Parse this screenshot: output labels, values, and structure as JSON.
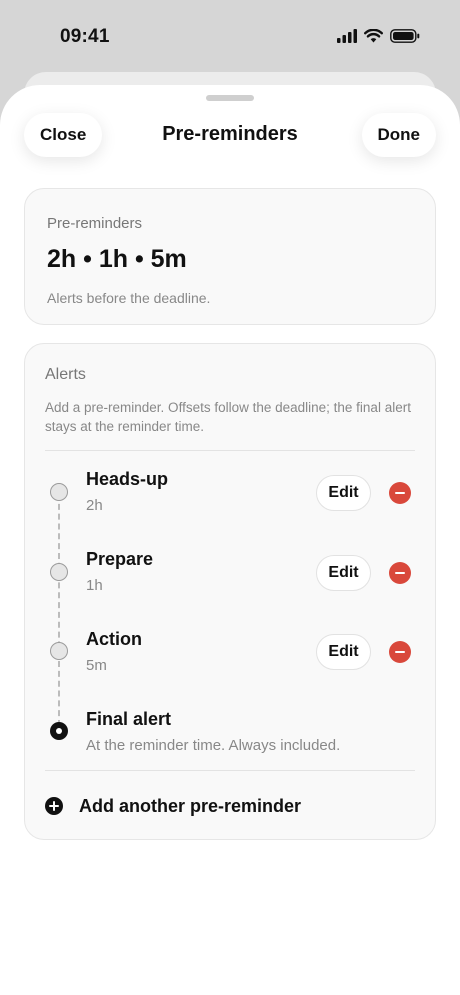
{
  "status_bar": {
    "time": "09:41",
    "icons": [
      "signal-icon",
      "wifi-icon",
      "battery-icon"
    ]
  },
  "nav": {
    "close_label": "Close",
    "title": "Pre-reminders",
    "done_label": "Done"
  },
  "summary": {
    "label": "Pre-reminders",
    "value": "2h • 1h • 5m",
    "description": "Alerts before the deadline."
  },
  "alerts": {
    "title": "Alerts",
    "description": "Add a pre-reminder. Offsets follow the deadline; the final alert stays at the reminder time.",
    "items": [
      {
        "title": "Heads-up",
        "offset": "2h",
        "edit_label": "Edit"
      },
      {
        "title": "Prepare",
        "offset": "1h",
        "edit_label": "Edit"
      },
      {
        "title": "Action",
        "offset": "5m",
        "edit_label": "Edit"
      }
    ],
    "final": {
      "title": "Final alert",
      "subtitle": "At the reminder time. Always included."
    },
    "add_label": "Add another pre-reminder"
  },
  "colors": {
    "remove": "#d9483b",
    "text": "#111111",
    "muted": "#888888"
  }
}
